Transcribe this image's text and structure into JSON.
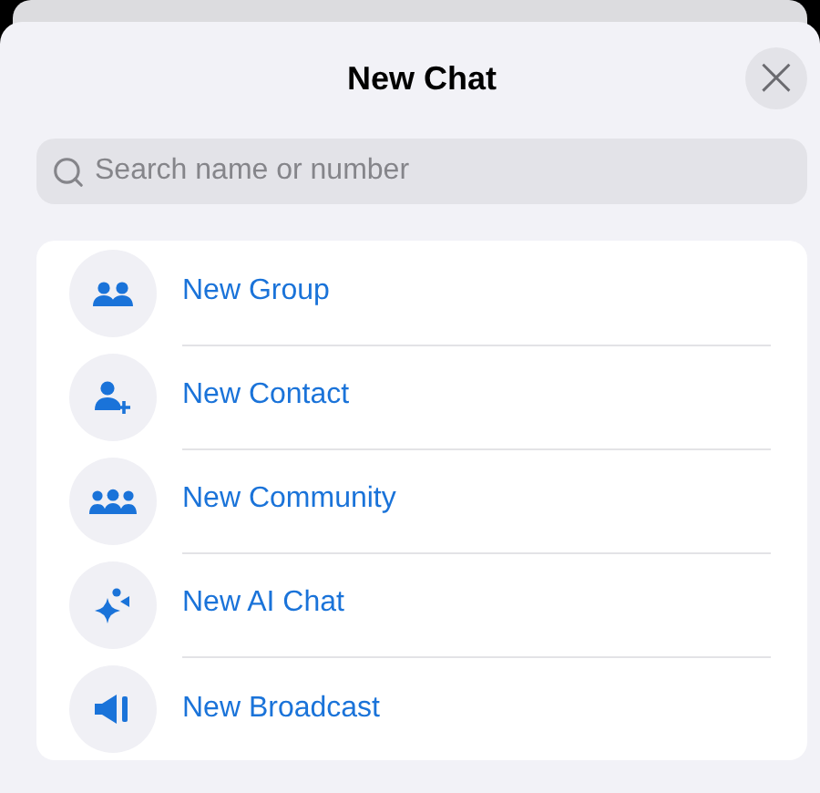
{
  "sheet": {
    "title": "New Chat",
    "close_label": "×"
  },
  "search": {
    "placeholder": "Search name or number"
  },
  "actions": [
    {
      "kind": "group",
      "label": "New Group"
    },
    {
      "kind": "contact",
      "label": "New Contact"
    },
    {
      "kind": "community",
      "label": "New Community"
    },
    {
      "kind": "ai",
      "label": "New AI Chat"
    },
    {
      "kind": "broadcast",
      "label": "New Broadcast"
    }
  ]
}
